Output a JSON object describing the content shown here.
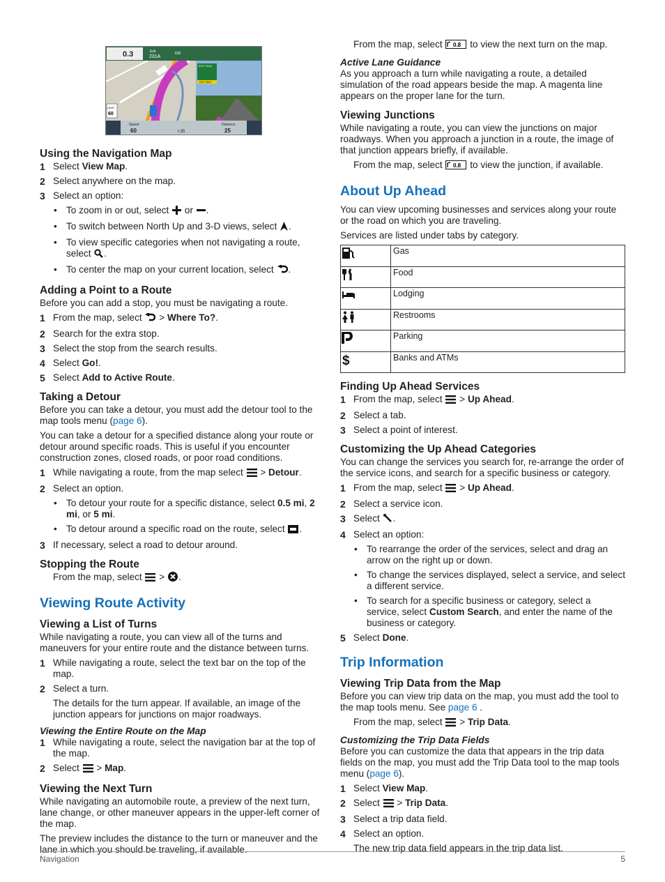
{
  "figure": {
    "turn_distance": "0.3",
    "turn_unit": "mi",
    "exit_label": "Exit",
    "exit_number": "231A",
    "shield_top": "635",
    "shield_map": "35",
    "sign_text": "EXIT 231A",
    "sign_only": "EXIT ONLY",
    "limit_label": "LIMIT",
    "limit_value": "60",
    "speed_label": "Speed",
    "speed_value": "60",
    "road_name": "I-35",
    "distance_label": "Distance",
    "distance_value": "25",
    "colors": {
      "top_bar": "#2e6b45",
      "route": "#c63bc0",
      "road": "#f39a1e"
    }
  },
  "left": [
    {
      "t": "h3",
      "c": [
        "Using the Navigation Map"
      ],
      "first": true
    },
    {
      "t": "step",
      "n": "1",
      "c": [
        "Select ",
        {
          "b": "View Map"
        },
        "."
      ]
    },
    {
      "t": "step",
      "n": "2",
      "c": [
        "Select anywhere on the map."
      ]
    },
    {
      "t": "step",
      "n": "3",
      "c": [
        "Select an option:"
      ]
    },
    {
      "t": "bullet",
      "c": [
        "To zoom in or out, select ",
        {
          "icon": "plus"
        },
        " or ",
        {
          "icon": "minus"
        },
        "."
      ]
    },
    {
      "t": "bullet",
      "c": [
        "To switch between North Up and 3-D views, select ",
        {
          "icon": "north"
        },
        "."
      ]
    },
    {
      "t": "bullet",
      "c": [
        "To view specific categories when not navigating a route, select ",
        {
          "icon": "search"
        },
        "."
      ]
    },
    {
      "t": "bullet",
      "c": [
        "To center the map on your current location, select ",
        {
          "icon": "back"
        },
        "."
      ]
    },
    {
      "t": "h3",
      "c": [
        "Adding a Point to a Route"
      ]
    },
    {
      "t": "p",
      "c": [
        "Before you can add a stop, you must be navigating a route."
      ]
    },
    {
      "t": "step",
      "n": "1",
      "c": [
        "From the map, select ",
        {
          "icon": "back"
        },
        " > ",
        {
          "b": "Where To?"
        },
        "."
      ]
    },
    {
      "t": "step",
      "n": "2",
      "c": [
        "Search for the extra stop."
      ]
    },
    {
      "t": "step",
      "n": "3",
      "c": [
        "Select the stop from the search results."
      ]
    },
    {
      "t": "step",
      "n": "4",
      "c": [
        "Select ",
        {
          "b": "Go!"
        },
        "."
      ]
    },
    {
      "t": "step",
      "n": "5",
      "c": [
        "Select ",
        {
          "b": "Add to Active Route"
        },
        "."
      ]
    },
    {
      "t": "h3",
      "c": [
        "Taking a Detour"
      ]
    },
    {
      "t": "p",
      "c": [
        "Before you can take a detour, you must add the detour tool to the map tools menu (",
        {
          "link": "page 6"
        },
        ")."
      ]
    },
    {
      "t": "p",
      "c": [
        "You can take a detour for a specified distance along your route or detour around specific roads. This is useful if you encounter construction zones, closed roads, or poor road conditions."
      ]
    },
    {
      "t": "step",
      "n": "1",
      "c": [
        "While navigating a route, from the map select ",
        {
          "icon": "menu"
        },
        " > ",
        {
          "b": "Detour"
        },
        "."
      ]
    },
    {
      "t": "step",
      "n": "2",
      "c": [
        "Select an option."
      ]
    },
    {
      "t": "bullet",
      "c": [
        "To detour your route for a specific distance, select ",
        {
          "b": "0.5 mi"
        },
        ", ",
        {
          "b": "2 mi"
        },
        ", or ",
        {
          "b": "5 mi"
        },
        "."
      ]
    },
    {
      "t": "bullet",
      "c": [
        "To detour around a specific road on the route, select ",
        {
          "icon": "detour"
        },
        "."
      ]
    },
    {
      "t": "step",
      "n": "3",
      "c": [
        "If necessary, select a road to detour around."
      ]
    },
    {
      "t": "h3",
      "c": [
        "Stopping the Route"
      ]
    },
    {
      "t": "indent",
      "c": [
        "From the map, select ",
        {
          "icon": "menu"
        },
        " > ",
        {
          "icon": "cancel"
        },
        "."
      ]
    },
    {
      "t": "h2",
      "c": [
        "Viewing Route Activity"
      ]
    },
    {
      "t": "h3",
      "c": [
        "Viewing a List of Turns"
      ]
    },
    {
      "t": "p",
      "c": [
        "While navigating a route, you can view all of the turns and maneuvers for your entire route and the distance between turns."
      ]
    },
    {
      "t": "step",
      "n": "1",
      "c": [
        "While navigating a route, select the text bar on the top of the map."
      ]
    },
    {
      "t": "step",
      "n": "2",
      "c": [
        "Select a turn."
      ]
    },
    {
      "t": "indent",
      "c": [
        "The details for the turn appear. If available, an image of the junction appears for junctions on major roadways."
      ]
    },
    {
      "t": "h4",
      "c": [
        "Viewing the Entire Route on the Map"
      ]
    },
    {
      "t": "step",
      "n": "1",
      "c": [
        "While navigating a route, select the navigation bar at the top of the map."
      ]
    },
    {
      "t": "step",
      "n": "2",
      "c": [
        "Select ",
        {
          "icon": "menu"
        },
        " > ",
        {
          "b": "Map"
        },
        "."
      ]
    },
    {
      "t": "h3",
      "c": [
        "Viewing the Next Turn"
      ]
    },
    {
      "t": "p",
      "c": [
        "While navigating an automobile route, a preview of the next turn, lane change, or other maneuver appears in the upper-left corner of the map."
      ]
    },
    {
      "t": "p",
      "c": [
        "The preview includes the distance to the turn or maneuver and the lane in which you should be traveling, if available."
      ]
    }
  ],
  "right": [
    {
      "t": "indent",
      "c": [
        "From the map, select ",
        {
          "icon": "turn"
        },
        " to view the next turn on the map."
      ],
      "first": true
    },
    {
      "t": "h4",
      "c": [
        "Active Lane Guidance"
      ]
    },
    {
      "t": "p",
      "c": [
        "As you approach a turn while navigating a route, a detailed simulation of the road appears beside the map. A magenta line appears on the proper lane for the turn."
      ]
    },
    {
      "t": "h3",
      "c": [
        "Viewing Junctions"
      ]
    },
    {
      "t": "p",
      "c": [
        "While navigating a route, you can view the junctions on major roadways. When you approach a junction in a route, the image of that junction appears briefly, if available."
      ]
    },
    {
      "t": "indent",
      "c": [
        "From the map, select ",
        {
          "icon": "turn"
        },
        " to view the junction, if available."
      ]
    },
    {
      "t": "h2",
      "c": [
        "About Up Ahead"
      ]
    },
    {
      "t": "p",
      "c": [
        "You can view upcoming businesses and services along your route or the road on which you are traveling."
      ]
    },
    {
      "t": "p",
      "c": [
        "Services are listed under tabs by category."
      ]
    },
    {
      "t": "table"
    },
    {
      "t": "h3",
      "c": [
        "Finding Up Ahead Services"
      ]
    },
    {
      "t": "step",
      "n": "1",
      "c": [
        "From the map, select ",
        {
          "icon": "menu"
        },
        " > ",
        {
          "b": "Up Ahead"
        },
        "."
      ]
    },
    {
      "t": "step",
      "n": "2",
      "c": [
        "Select a tab."
      ]
    },
    {
      "t": "step",
      "n": "3",
      "c": [
        "Select a point of interest."
      ]
    },
    {
      "t": "h3",
      "c": [
        "Customizing the Up Ahead Categories"
      ]
    },
    {
      "t": "p",
      "c": [
        "You can change the services you search for, re-arrange the order of the service icons, and search for a specific business or category."
      ]
    },
    {
      "t": "step",
      "n": "1",
      "c": [
        "From the map, select ",
        {
          "icon": "menu"
        },
        " > ",
        {
          "b": "Up Ahead"
        },
        "."
      ]
    },
    {
      "t": "step",
      "n": "2",
      "c": [
        "Select a service icon."
      ]
    },
    {
      "t": "step",
      "n": "3",
      "c": [
        "Select ",
        {
          "icon": "wrench"
        },
        "."
      ]
    },
    {
      "t": "step",
      "n": "4",
      "c": [
        "Select an option:"
      ]
    },
    {
      "t": "bullet",
      "c": [
        "To rearrange the order of the services, select and drag an arrow on the right up or down."
      ]
    },
    {
      "t": "bullet",
      "c": [
        "To change the services displayed, select a service, and select a different service."
      ]
    },
    {
      "t": "bullet",
      "c": [
        "To search for a specific business or category, select a service, select ",
        {
          "b": "Custom Search"
        },
        ", and enter the name of the business or category."
      ]
    },
    {
      "t": "step",
      "n": "5",
      "c": [
        "Select ",
        {
          "b": "Done"
        },
        "."
      ]
    },
    {
      "t": "h2",
      "c": [
        "Trip Information"
      ]
    },
    {
      "t": "h3",
      "c": [
        "Viewing Trip Data from the Map"
      ]
    },
    {
      "t": "p",
      "c": [
        "Before you can view trip data on the map, you must add the tool to the map tools menu. See ",
        {
          "link": "page 6"
        },
        " ."
      ]
    },
    {
      "t": "indent",
      "c": [
        "From the map, select ",
        {
          "icon": "menu"
        },
        " > ",
        {
          "b": "Trip Data"
        },
        "."
      ]
    },
    {
      "t": "h4",
      "c": [
        "Customizing the Trip Data Fields"
      ]
    },
    {
      "t": "p",
      "c": [
        "Before you can customize the data that appears in the trip data fields on the map, you must add the Trip Data tool to the map tools menu (",
        {
          "link": "page 6"
        },
        ")."
      ]
    },
    {
      "t": "step",
      "n": "1",
      "c": [
        "Select ",
        {
          "b": "View Map"
        },
        "."
      ]
    },
    {
      "t": "step",
      "n": "2",
      "c": [
        "Select ",
        {
          "icon": "menu"
        },
        " > ",
        {
          "b": "Trip Data"
        },
        "."
      ]
    },
    {
      "t": "step",
      "n": "3",
      "c": [
        "Select a trip data field."
      ]
    },
    {
      "t": "step",
      "n": "4",
      "c": [
        "Select an option."
      ]
    },
    {
      "t": "indent",
      "c": [
        "The new trip data field appears in the trip data list."
      ]
    }
  ],
  "categories": [
    {
      "icon": "gas-pump",
      "label": "Gas"
    },
    {
      "icon": "fork-knife",
      "label": "Food"
    },
    {
      "icon": "bed",
      "label": "Lodging"
    },
    {
      "icon": "restroom",
      "label": "Restrooms"
    },
    {
      "icon": "parking",
      "label": "Parking"
    },
    {
      "icon": "dollar",
      "label": "Banks and ATMs"
    }
  ],
  "footer": {
    "section": "Navigation",
    "page": "5"
  }
}
